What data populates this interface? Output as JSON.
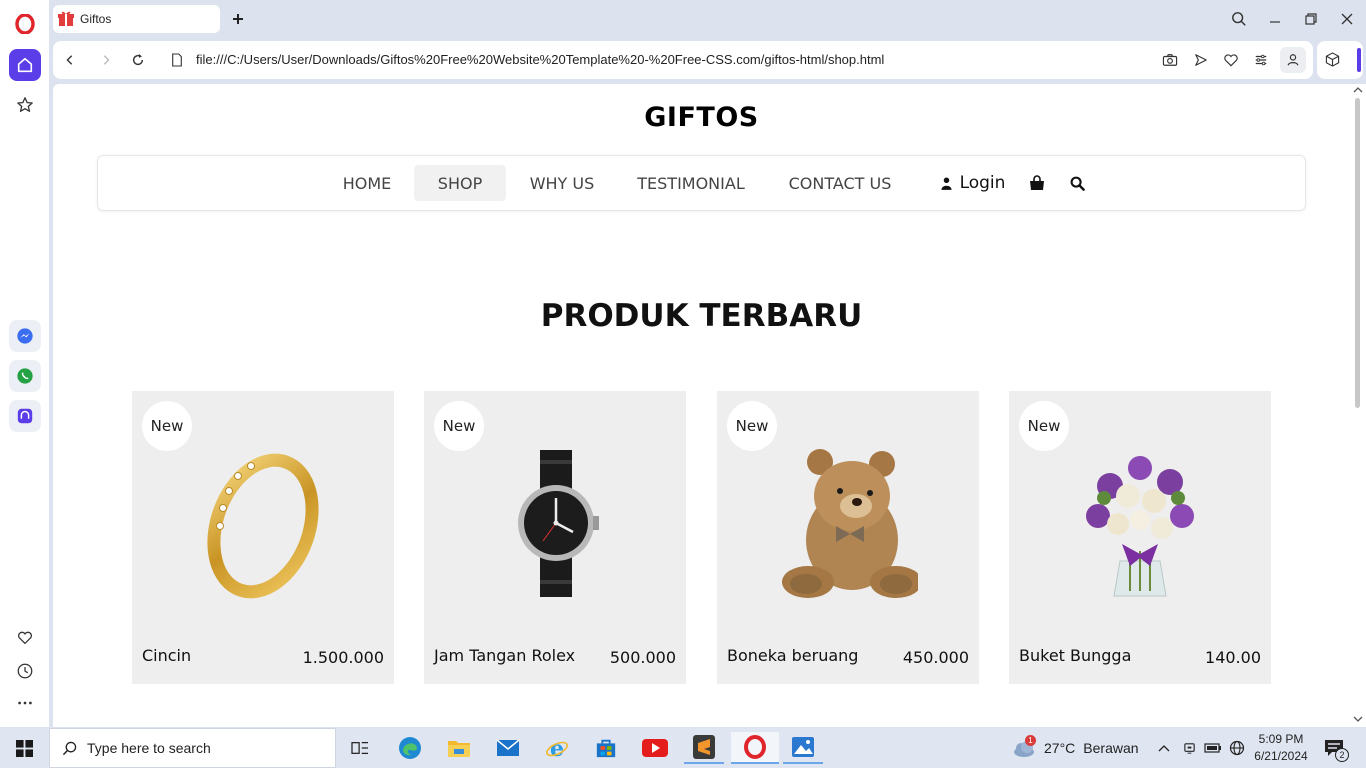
{
  "browser": {
    "tab_title": "Giftos",
    "url": "file:///C:/Users/User/Downloads/Giftos%20Free%20Website%20Template%20-%20Free-CSS.com/giftos-html/shop.html"
  },
  "site": {
    "brand": "GIFTOS",
    "nav": {
      "home": "HOME",
      "shop": "SHOP",
      "why_us": "WHY US",
      "testimonial": "TESTIMONIAL",
      "contact_us": "CONTACT US",
      "login": "Login"
    },
    "section_heading": "PRODUK TERBARU",
    "products": [
      {
        "badge": "New",
        "name": "Cincin",
        "price": "1.500.000",
        "image": "ring"
      },
      {
        "badge": "New",
        "name": "Jam Tangan Rolex",
        "price": "500.000",
        "image": "watch"
      },
      {
        "badge": "New",
        "name": "Boneka beruang",
        "price": "450.000",
        "image": "teddy-bear"
      },
      {
        "badge": "New",
        "name": "Buket Bungga",
        "price": "140.00",
        "image": "flower-bouquet"
      }
    ]
  },
  "taskbar": {
    "search_placeholder": "Type here to search",
    "weather_temp": "27°C",
    "weather_desc": "Berawan",
    "weather_alert_count": "1",
    "time": "5:09 PM",
    "date": "6/21/2024",
    "notification_count": "2"
  },
  "colors": {
    "opera_red": "#e0242b",
    "sidebar_accent": "#5b3ee8",
    "card_bg": "#eeeeee"
  }
}
